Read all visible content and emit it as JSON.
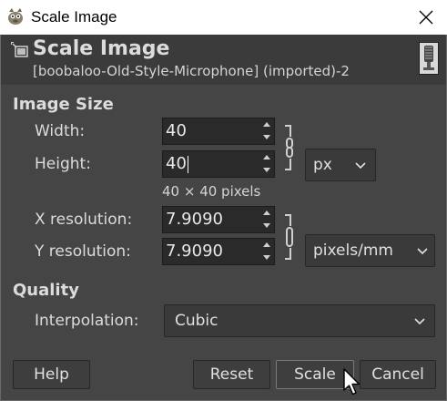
{
  "window": {
    "title": "Scale Image"
  },
  "header": {
    "title": "Scale Image",
    "subtitle": "[boobaloo-Old-Style-Microphone] (imported)-2"
  },
  "image_size": {
    "section_title": "Image Size",
    "width_label": "Width:",
    "width_value": "40",
    "height_label": "Height:",
    "height_value": "40",
    "unit": "px",
    "size_info": "40 × 40 pixels",
    "xres_label": "X resolution:",
    "xres_value": "7.9090",
    "yres_label": "Y resolution:",
    "yres_value": "7.9090",
    "res_unit": "pixels/mm"
  },
  "quality": {
    "section_title": "Quality",
    "interp_label": "Interpolation:",
    "interp_value": "Cubic"
  },
  "buttons": {
    "help": "Help",
    "reset": "Reset",
    "scale": "Scale",
    "cancel": "Cancel"
  }
}
